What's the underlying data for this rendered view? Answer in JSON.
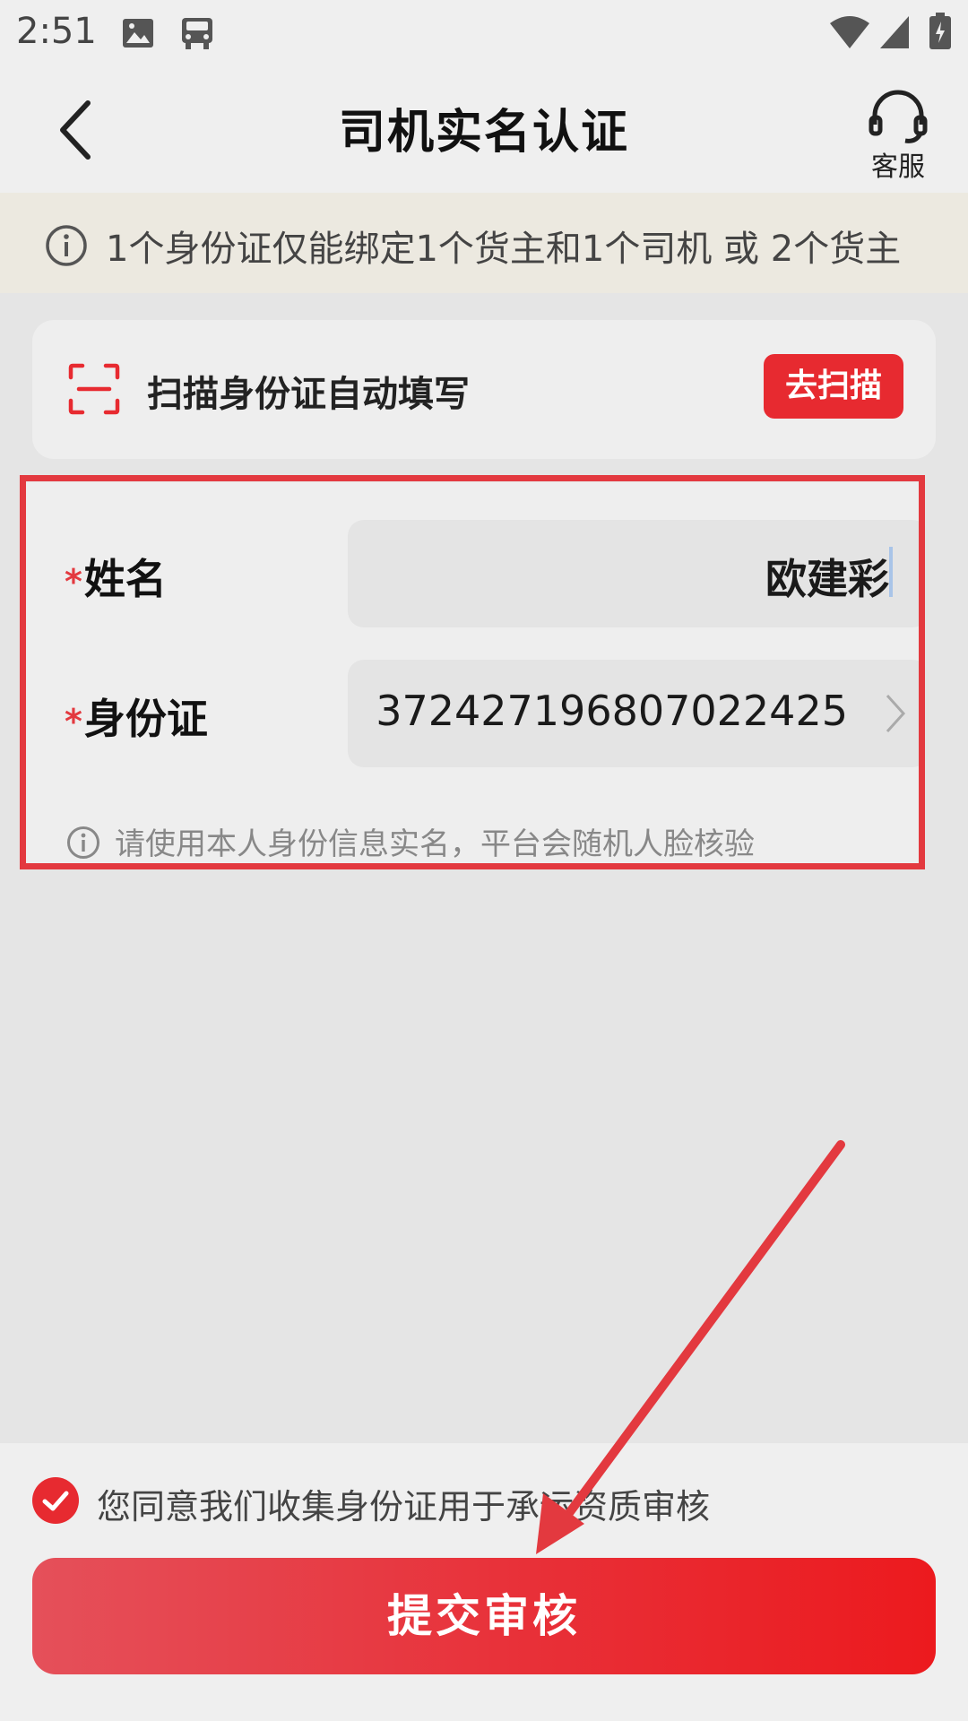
{
  "status_bar": {
    "time": "2:51"
  },
  "header": {
    "title": "司机实名认证",
    "service_label": "客服"
  },
  "notice": {
    "text": "1个身份证仅能绑定1个货主和1个司机 或 2个货主"
  },
  "scan": {
    "label": "扫描身份证自动填写",
    "button": "去扫描"
  },
  "form": {
    "required_mark": "*",
    "name_label": "姓名",
    "name_value": "欧建彩",
    "id_label": "身份证",
    "id_value": "372427196807022425",
    "hint": "请使用本人身份信息实名，平台会随机人脸核验"
  },
  "agreement": {
    "text": "您同意我们收集身份证用于承运资质审核"
  },
  "submit": {
    "label": "提交审核"
  },
  "colors": {
    "accent": "#e72a30",
    "annotation": "#e3393f"
  }
}
